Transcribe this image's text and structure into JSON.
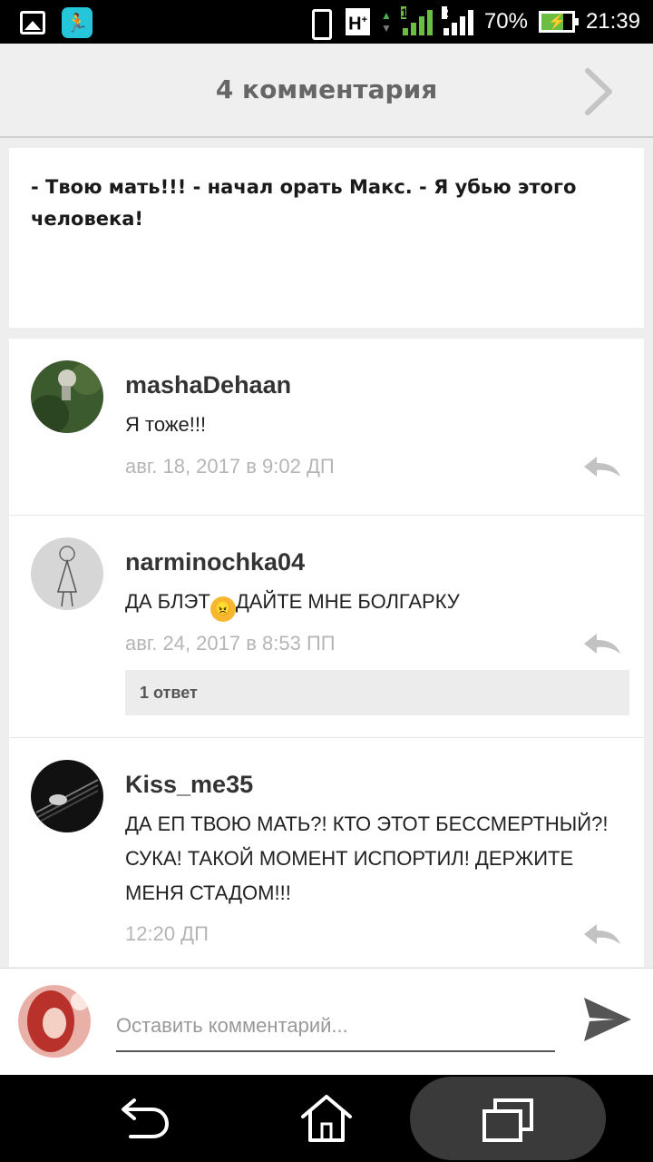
{
  "status_bar": {
    "battery_percent": "70%",
    "time": "21:39",
    "network_type": "H",
    "network_sup": "+",
    "sim1_label": "1",
    "sim2_label": "2"
  },
  "header": {
    "title": "4 комментария"
  },
  "story": {
    "text": "- Твою мать!!! - начал орать Макс. - Я убью этого человека!"
  },
  "comments": [
    {
      "author": "mashaDehaan",
      "text": "Я тоже!!!",
      "time": "авг. 18, 2017 в 9:02 ДП"
    },
    {
      "author": "narminochka04",
      "text_before": "ДА БЛЭТ",
      "emoji": "😠",
      "text_after": "ДАЙТЕ МНЕ БОЛГАРКУ",
      "time": "авг. 24, 2017 в 8:53 ПП",
      "replies_label": "1 ответ"
    },
    {
      "author": "Kiss_me35",
      "text": "ДА ЕП ТВОЮ МАТЬ?! КТО ЭТОТ БЕССМЕРТНЫЙ?! СУКА! ТАКОЙ МОМЕНТ ИСПОРТИЛ! ДЕРЖИТЕ МЕНЯ СТАДОМ!!!",
      "time": "12:20 ДП"
    }
  ],
  "composer": {
    "placeholder": "Оставить комментарий..."
  },
  "colors": {
    "accent_green": "#6abf43",
    "app_icon_teal": "#26c6da",
    "muted_text": "#b5b5b5"
  },
  "icons": {
    "status_left": [
      "gallery-icon",
      "fitness-app-icon"
    ],
    "status_right": [
      "vibrate-icon",
      "signal-icon",
      "battery-icon"
    ],
    "header": "chevron-right-icon",
    "comment_action": "reply-icon",
    "composer": "send-icon",
    "nav": [
      "back-icon",
      "home-icon",
      "recent-apps-icon"
    ]
  }
}
